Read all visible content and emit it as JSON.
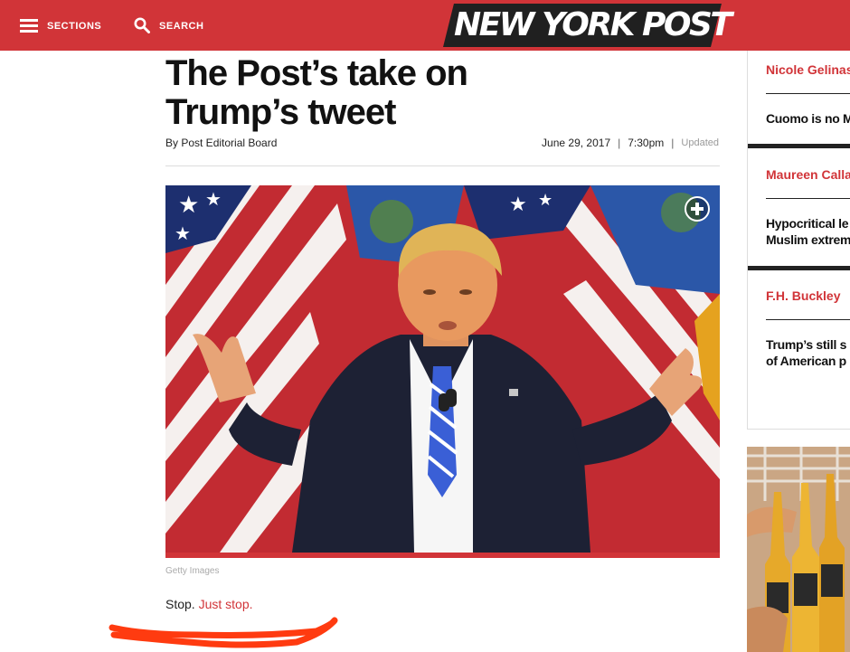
{
  "header": {
    "sections_label": "SECTIONS",
    "search_label": "SEARCH",
    "logo_text": "NEW YORK POST",
    "brand_color": "#d13438"
  },
  "article": {
    "headline_line1": "The Post’s take on",
    "headline_line2": "Trump’s tweet",
    "byline": "By Post Editorial Board",
    "date": "June 29, 2017",
    "time": "7:30pm",
    "updated_label": "Updated",
    "photo_credit": "Getty Images",
    "body_plain": "Stop. ",
    "body_link": "Just stop."
  },
  "sidebar": {
    "items": [
      {
        "author": "Nicole Gelinas",
        "title": "Cuomo is no M"
      },
      {
        "author": "Maureen Callahan",
        "title_line1": "Hypocritical le",
        "title_line2": "Muslim extrem"
      },
      {
        "author": "F.H. Buckley",
        "title_line1": "Trump’s still s",
        "title_line2": "of American p"
      }
    ]
  },
  "icons": {
    "menu": "hamburger-icon",
    "search": "magnifier-icon",
    "expand": "plus-circle-icon"
  }
}
